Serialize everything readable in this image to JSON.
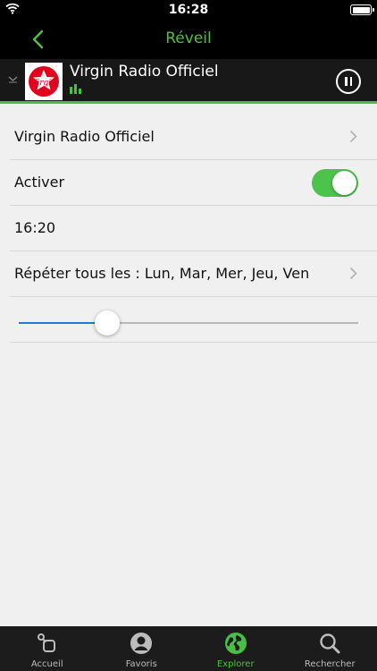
{
  "status": {
    "time": "16:28"
  },
  "nav": {
    "title": "Réveil"
  },
  "player": {
    "station": "Virgin Radio Officiel",
    "logo_text": "Virgin"
  },
  "settings": {
    "station_row": "Virgin Radio Officiel",
    "activate_label": "Activer",
    "activate_on": true,
    "time": "16:20",
    "repeat_label": "Répéter tous les : Lun, Mar, Mer, Jeu, Ven",
    "volume_fraction": 0.26
  },
  "tabs": [
    {
      "label": "Accueil",
      "icon": "home-icon",
      "active": false
    },
    {
      "label": "Favoris",
      "icon": "profile-icon",
      "active": false
    },
    {
      "label": "Explorer",
      "icon": "globe-icon",
      "active": true
    },
    {
      "label": "Rechercher",
      "icon": "search-icon",
      "active": false
    }
  ],
  "colors": {
    "accent": "#52c03e",
    "slider": "#1e7bd8",
    "logo_red": "#e1001e"
  }
}
